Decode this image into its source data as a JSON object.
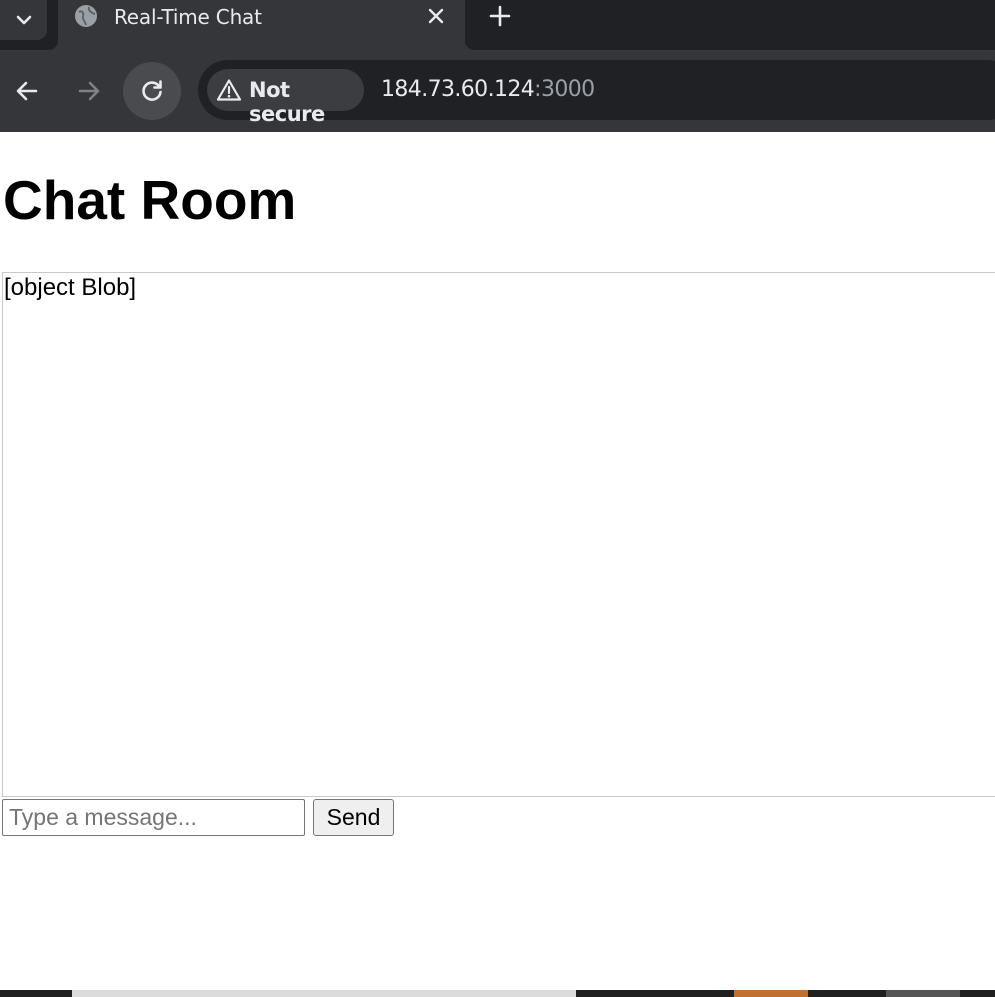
{
  "browser": {
    "tab": {
      "title": "Real-Time Chat"
    },
    "address": {
      "security_label": "Not secure",
      "host": "184.73.60.124",
      "port": ":3000"
    }
  },
  "page": {
    "title": "Chat Room",
    "messages": [
      "[object Blob]"
    ],
    "input": {
      "value": "",
      "placeholder": "Type a message..."
    },
    "send_label": "Send"
  },
  "colors": {
    "chrome_dark": "#202124",
    "chrome_tab": "#35363a",
    "text_light": "#e8eaed",
    "taskbar_accent": "#c07030"
  }
}
